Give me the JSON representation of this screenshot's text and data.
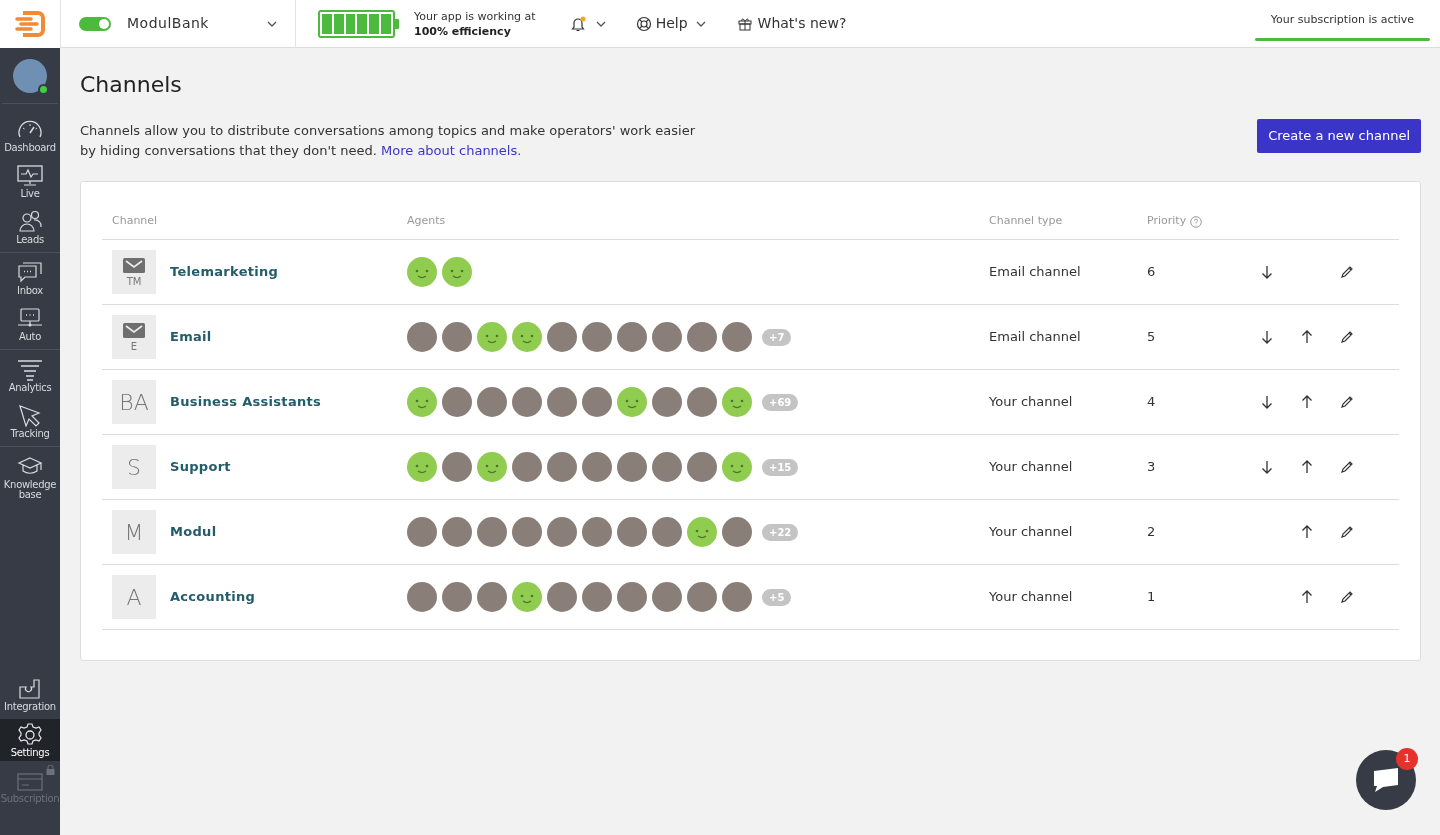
{
  "topbar": {
    "project_toggle_on": true,
    "project": "ModulBank",
    "battery": {
      "level": 1.0
    },
    "efficiency_line1": "Your app is working at",
    "efficiency_line2": "100% efficiency",
    "has_notification": true,
    "help": "Help",
    "whats_new": "What's new?",
    "subscription": "Your subscription is active"
  },
  "sidebar": {
    "user_online": true,
    "groups": [
      [
        {
          "kind": "gauge",
          "label": "Dashboard",
          "selected": false,
          "locked": false
        },
        {
          "kind": "monitor",
          "label": "Live",
          "selected": false,
          "locked": false
        },
        {
          "kind": "people",
          "label": "Leads",
          "selected": false,
          "locked": false
        }
      ],
      [
        {
          "kind": "chat",
          "label": "Inbox",
          "selected": false,
          "locked": false
        },
        {
          "kind": "auto",
          "label": "Auto",
          "selected": false,
          "locked": false
        }
      ],
      [
        {
          "kind": "funnel",
          "label": "Analytics",
          "selected": false,
          "locked": false
        },
        {
          "kind": "cursor",
          "label": "Tracking",
          "selected": false,
          "locked": false
        }
      ],
      [
        {
          "kind": "cap",
          "label": "Knowledge base",
          "selected": false,
          "locked": false
        }
      ]
    ],
    "bottom": [
      {
        "kind": "puzzle",
        "label": "Integration",
        "selected": false,
        "locked": false
      },
      {
        "kind": "gear",
        "label": "Settings",
        "selected": true,
        "locked": false
      },
      {
        "kind": "card",
        "label": "Subscription",
        "selected": false,
        "locked": true
      }
    ]
  },
  "page": {
    "title": "Channels",
    "description": "Channels allow you to distribute conversations among topics and make operators' work easier by hiding conversations that they don't need.",
    "link": "More about channels.",
    "create_button": "Create a new channel"
  },
  "table": {
    "columns": [
      "Channel",
      "Agents",
      "Channel type",
      "Priority"
    ],
    "rows": [
      {
        "kind": "email",
        "badge": "TM",
        "name": "Telemarketing",
        "agents": [
          {
            "kind": "smiley"
          },
          {
            "kind": "smiley"
          }
        ],
        "type": "Email channel",
        "priority": "6",
        "can_move_down": true,
        "can_move_up": false
      },
      {
        "kind": "email",
        "badge": "E",
        "name": "Email",
        "agents": [
          {
            "kind": "photo"
          },
          {
            "kind": "photo"
          },
          {
            "kind": "smiley"
          },
          {
            "kind": "smiley"
          },
          {
            "kind": "photo"
          },
          {
            "kind": "photo"
          },
          {
            "kind": "photo"
          },
          {
            "kind": "photo"
          },
          {
            "kind": "photo"
          },
          {
            "kind": "photo"
          }
        ],
        "more": "+7",
        "type": "Email channel",
        "priority": "5",
        "can_move_down": true,
        "can_move_up": true
      },
      {
        "kind": "initials",
        "badge": "BA",
        "name": "Business Assistants",
        "agents": [
          {
            "kind": "smiley"
          },
          {
            "kind": "photo"
          },
          {
            "kind": "photo"
          },
          {
            "kind": "photo"
          },
          {
            "kind": "photo"
          },
          {
            "kind": "photo"
          },
          {
            "kind": "smiley"
          },
          {
            "kind": "photo"
          },
          {
            "kind": "photo"
          },
          {
            "kind": "smiley"
          }
        ],
        "more": "+69",
        "type": "Your channel",
        "priority": "4",
        "can_move_down": true,
        "can_move_up": true
      },
      {
        "kind": "initials",
        "badge": "S",
        "name": "Support",
        "agents": [
          {
            "kind": "smiley"
          },
          {
            "kind": "photo"
          },
          {
            "kind": "smiley"
          },
          {
            "kind": "photo"
          },
          {
            "kind": "photo"
          },
          {
            "kind": "photo"
          },
          {
            "kind": "photo"
          },
          {
            "kind": "photo"
          },
          {
            "kind": "photo"
          },
          {
            "kind": "smiley"
          }
        ],
        "more": "+15",
        "type": "Your channel",
        "priority": "3",
        "can_move_down": true,
        "can_move_up": true
      },
      {
        "kind": "initials",
        "badge": "M",
        "name": "Modul",
        "agents": [
          {
            "kind": "photo"
          },
          {
            "kind": "photo"
          },
          {
            "kind": "photo"
          },
          {
            "kind": "photo"
          },
          {
            "kind": "photo"
          },
          {
            "kind": "photo"
          },
          {
            "kind": "photo"
          },
          {
            "kind": "photo"
          },
          {
            "kind": "smiley"
          },
          {
            "kind": "photo"
          }
        ],
        "more": "+22",
        "type": "Your channel",
        "priority": "2",
        "can_move_down": false,
        "can_move_up": true
      },
      {
        "kind": "initials",
        "badge": "A",
        "name": "Accounting",
        "agents": [
          {
            "kind": "photo"
          },
          {
            "kind": "photo"
          },
          {
            "kind": "photo"
          },
          {
            "kind": "smiley"
          },
          {
            "kind": "photo"
          },
          {
            "kind": "photo"
          },
          {
            "kind": "photo"
          },
          {
            "kind": "photo"
          },
          {
            "kind": "photo"
          },
          {
            "kind": "photo"
          }
        ],
        "more": "+5",
        "type": "Your channel",
        "priority": "1",
        "can_move_down": false,
        "can_move_up": true
      }
    ]
  },
  "chat_widget": {
    "badge": "1"
  }
}
